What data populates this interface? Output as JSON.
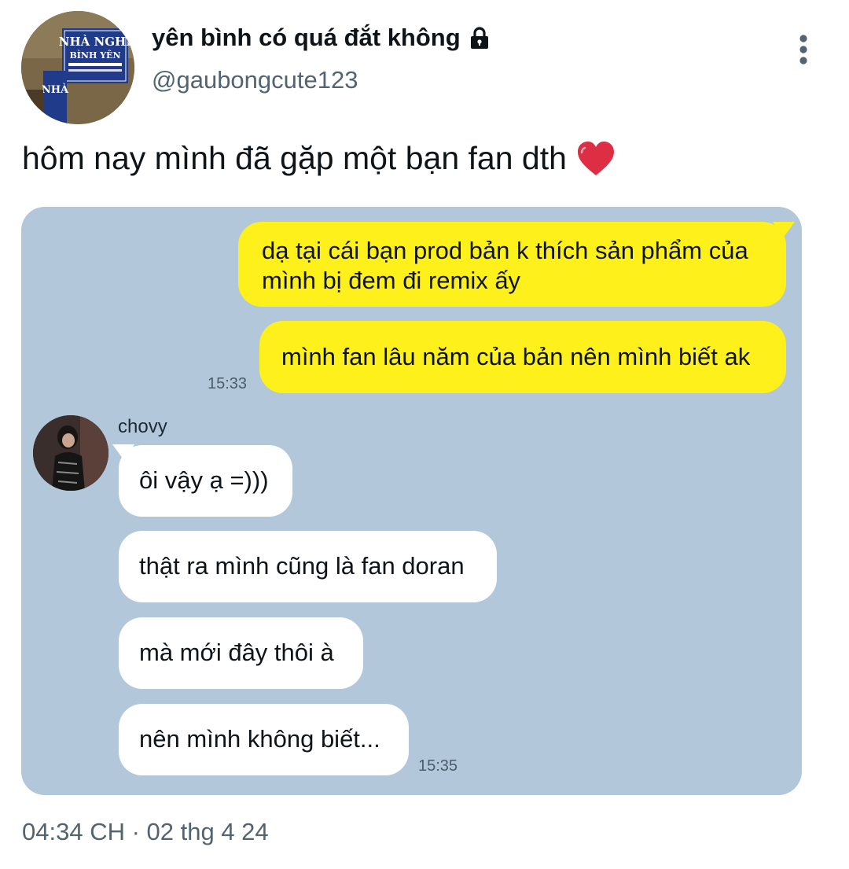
{
  "author": {
    "display_name": "yên bình có quá đắt không",
    "handle": "@gaubongcute123",
    "avatar_sign": {
      "line1": "NHÀ NGHỈ",
      "line2": "BÌNH YÊN",
      "side": "NHÀ"
    }
  },
  "tweet": {
    "text": "hôm nay mình đã gặp một bạn fan dth",
    "timestamp": "04:34 CH · 02 thg 4 24"
  },
  "chat": {
    "outgoing": [
      {
        "line1": "dạ tại cái bạn prod bản k thích sản phẩm của",
        "line2": "mình bị đem đi remix ấy"
      },
      {
        "line1": "mình fan lâu năm của bản nên mình biết ak"
      }
    ],
    "outgoing_time": "15:33",
    "sender_name": "chovy",
    "incoming": [
      {
        "text": "ôi vậy ạ =)))"
      },
      {
        "text": "thật ra mình cũng là fan doran"
      },
      {
        "text": "mà mới đây thôi à"
      },
      {
        "text": "nên mình không biết..."
      }
    ],
    "incoming_time": "15:35"
  },
  "colors": {
    "chat_bg": "#b2c7d9",
    "outgoing_bubble": "#fef01b",
    "incoming_bubble": "#ffffff",
    "secondary_text": "#536471"
  },
  "icons": {
    "lock": "lock-icon",
    "more": "more-vertical-icon",
    "heart": "red-heart-icon"
  }
}
